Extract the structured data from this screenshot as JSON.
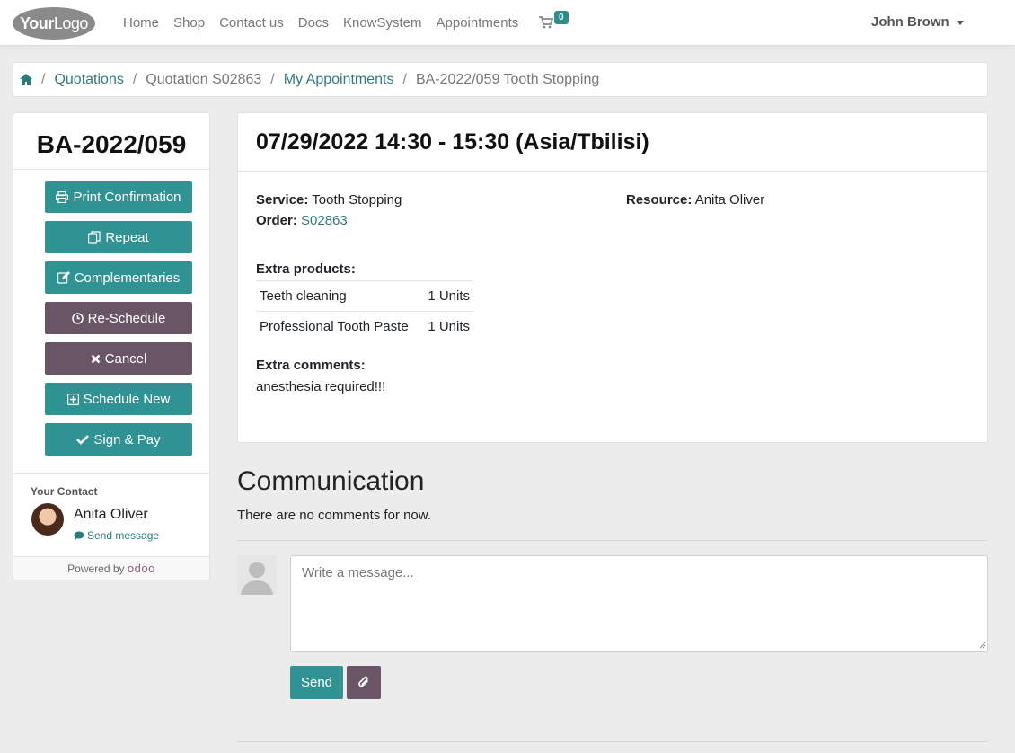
{
  "navbar": {
    "logo_a": "Your",
    "logo_b": "Logo",
    "links": [
      "Home",
      "Shop",
      "Contact us",
      "Docs",
      "KnowSystem",
      "Appointments"
    ],
    "cart_count": "0",
    "user_name": "John Brown"
  },
  "breadcrumb": {
    "items": [
      "Quotations",
      "Quotation S02863",
      "My Appointments",
      "BA-2022/059 Tooth Stopping"
    ]
  },
  "sidebar": {
    "title": "BA-2022/059",
    "buttons": [
      "Print Confirmation",
      "Repeat",
      "Complementaries",
      "Re-Schedule",
      "Cancel",
      "Schedule New",
      "Sign & Pay"
    ],
    "contact_heading": "Your Contact",
    "contact_name": "Anita Oliver",
    "send_message": "Send message",
    "powered_by": "Powered by",
    "powered_brand": "odoo"
  },
  "appointment": {
    "header": "07/29/2022 14:30 - 15:30 (Asia/Tbilisi)",
    "service_label": "Service:",
    "service_value": "Tooth Stopping",
    "order_label": "Order:",
    "order_value": "S02863",
    "resource_label": "Resource:",
    "resource_value": "Anita Oliver",
    "extra_products_title": "Extra products:",
    "extra_products": [
      {
        "name": "Teeth cleaning",
        "qty": "1 Units"
      },
      {
        "name": "Professional Tooth Paste",
        "qty": "1 Units"
      }
    ],
    "extra_comments_title": "Extra comments:",
    "extra_comments": "anesthesia required!!!"
  },
  "communication": {
    "title": "Communication",
    "no_comments": "There are no comments for now.",
    "placeholder": "Write a message...",
    "send_label": "Send"
  },
  "colors": {
    "teal": "#2f9393",
    "purple": "#6a5566",
    "link": "#2d7c7c"
  }
}
